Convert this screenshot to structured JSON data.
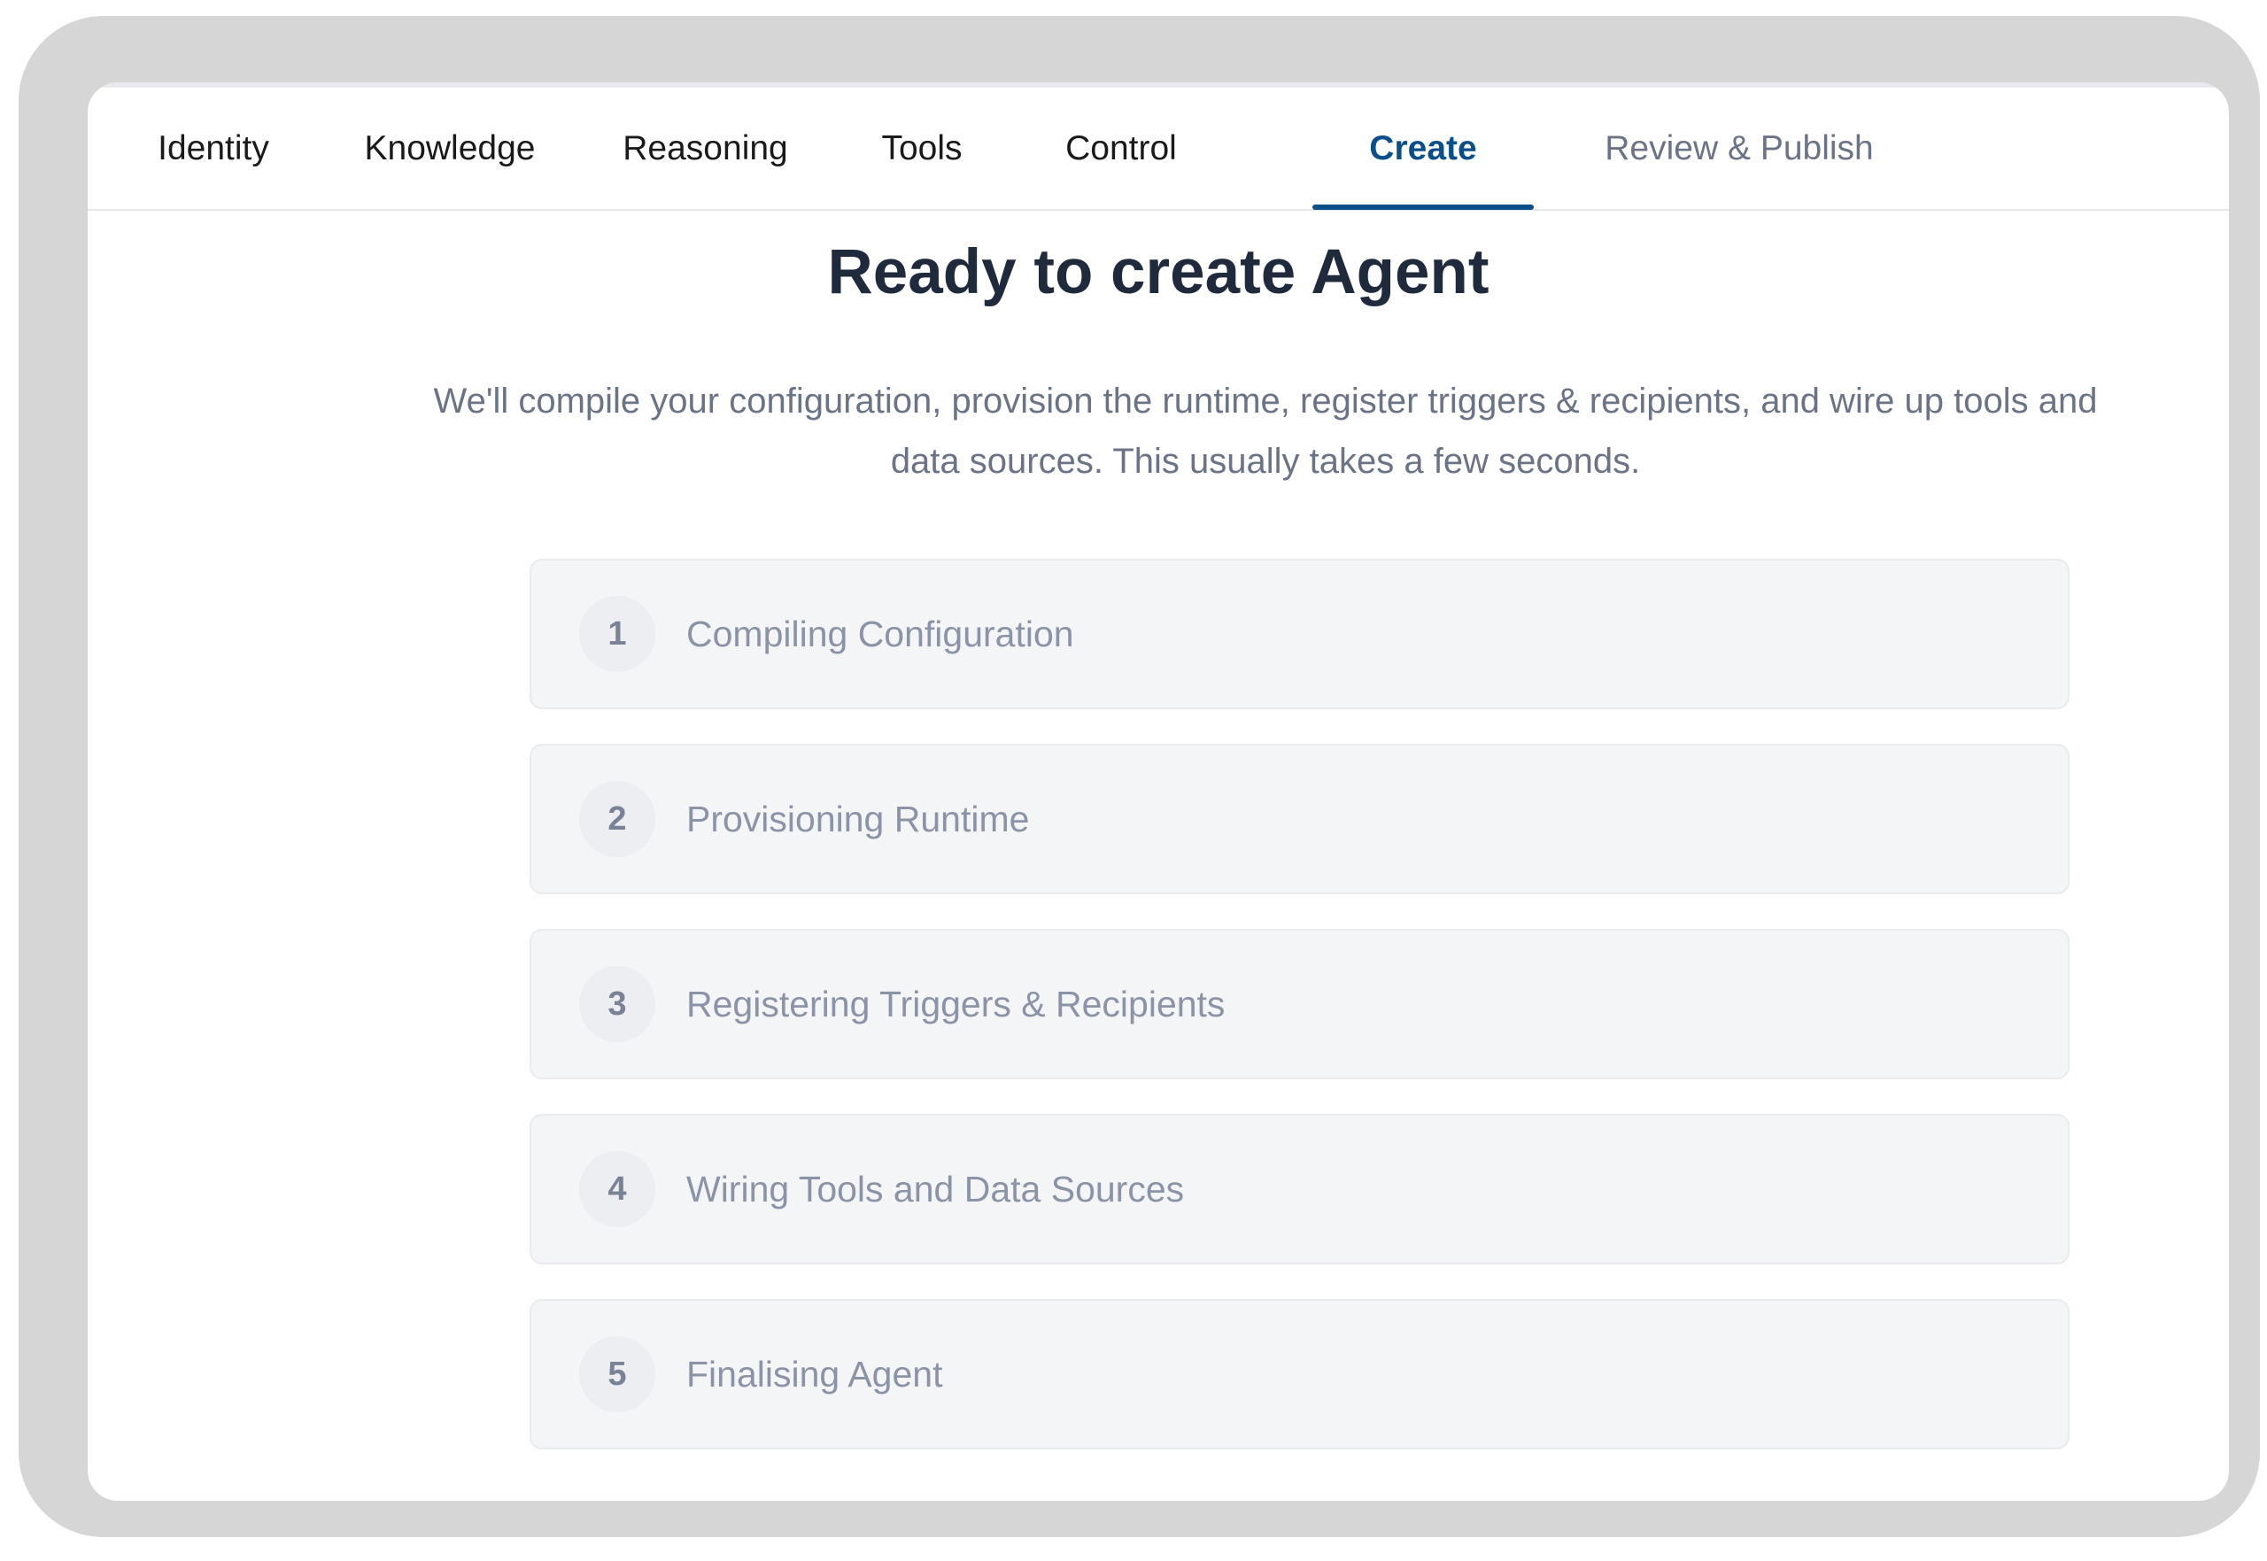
{
  "tabs": [
    {
      "label": "Identity",
      "state": "default"
    },
    {
      "label": "Knowledge",
      "state": "default"
    },
    {
      "label": "Reasoning",
      "state": "default"
    },
    {
      "label": "Tools",
      "state": "default"
    },
    {
      "label": "Control",
      "state": "default"
    },
    {
      "label": "Create",
      "state": "active"
    },
    {
      "label": "Review & Publish",
      "state": "muted"
    }
  ],
  "main": {
    "title": "Ready to create Agent",
    "description": "We'll compile your configuration, provision the runtime, register triggers & recipients, and wire up tools and data sources. This usually takes a few seconds."
  },
  "steps": [
    {
      "number": "1",
      "label": "Compiling Configuration"
    },
    {
      "number": "2",
      "label": "Provisioning Runtime"
    },
    {
      "number": "3",
      "label": "Registering Triggers & Recipients"
    },
    {
      "number": "4",
      "label": "Wiring Tools and Data Sources"
    },
    {
      "number": "5",
      "label": "Finalising Agent"
    }
  ],
  "colors": {
    "accent": "#0b4f8a",
    "heading": "#1f2a3c",
    "muted_text": "#6b7486",
    "step_background": "#f4f5f7",
    "device_frame": "#d6d6d6"
  }
}
